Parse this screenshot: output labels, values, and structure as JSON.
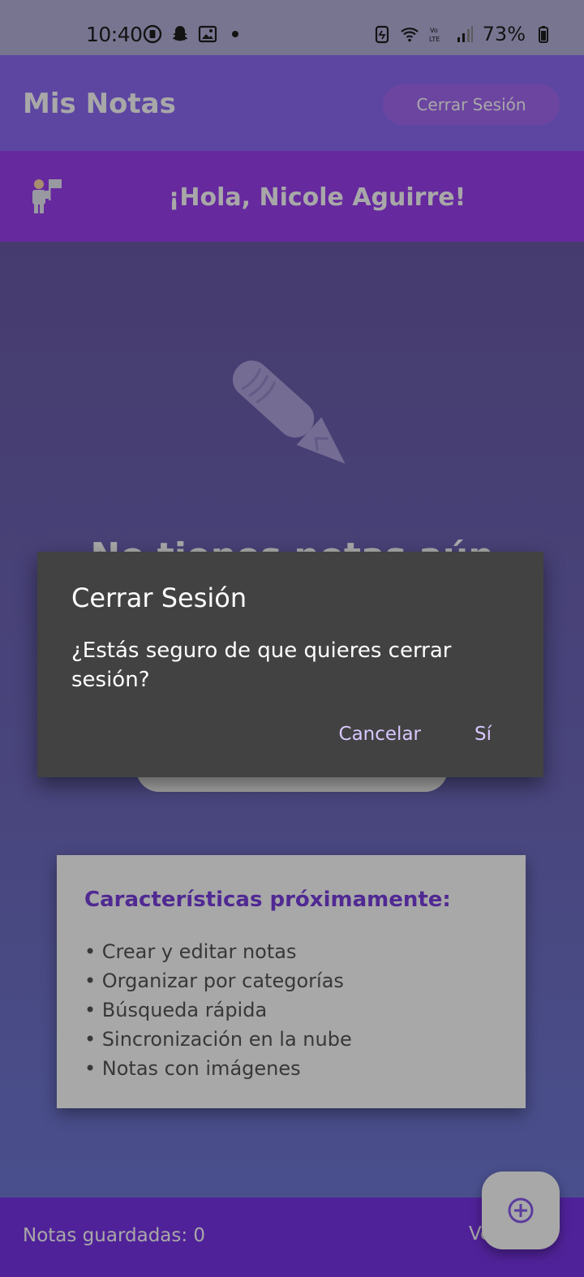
{
  "status_bar": {
    "time": "10:40",
    "battery": "73%",
    "icons_left": [
      "screen-record-icon",
      "snapchat-icon",
      "gallery-icon",
      "dot-icon"
    ],
    "icons_right": [
      "battery-saver-icon",
      "wifi-icon",
      "volte-icon",
      "signal-icon",
      "battery-icon"
    ]
  },
  "app_bar": {
    "title": "Mis Notas",
    "logout_label": "Cerrar Sesión"
  },
  "greeting": {
    "text": "¡Hola, Nicole Aguirre!",
    "icon": "person-waving-icon"
  },
  "main": {
    "empty_icon": "pencil-icon",
    "empty_title": "No tienes notas aún"
  },
  "features": {
    "title": "Características próximamente:",
    "items": [
      "• Crear y editar notas",
      "• Organizar por categorías",
      "• Búsqueda rápida",
      "• Sincronización en la nube",
      "• Notas con imágenes"
    ]
  },
  "bottom_bar": {
    "notes_count": "Notas guardadas: 0",
    "version": "Ve"
  },
  "fab": {
    "icon": "add-circle-icon"
  },
  "dialog": {
    "title": "Cerrar Sesión",
    "message": "¿Estás seguro de que quieres cerrar sesión?",
    "cancel_label": "Cancelar",
    "confirm_label": "Sí"
  },
  "colors": {
    "app_bar": "#8d6bf6",
    "greeting_bar": "#9b3ff0",
    "accent": "#7a3fe0",
    "dialog_bg": "#424242",
    "dialog_button": "#d9c8ff"
  }
}
